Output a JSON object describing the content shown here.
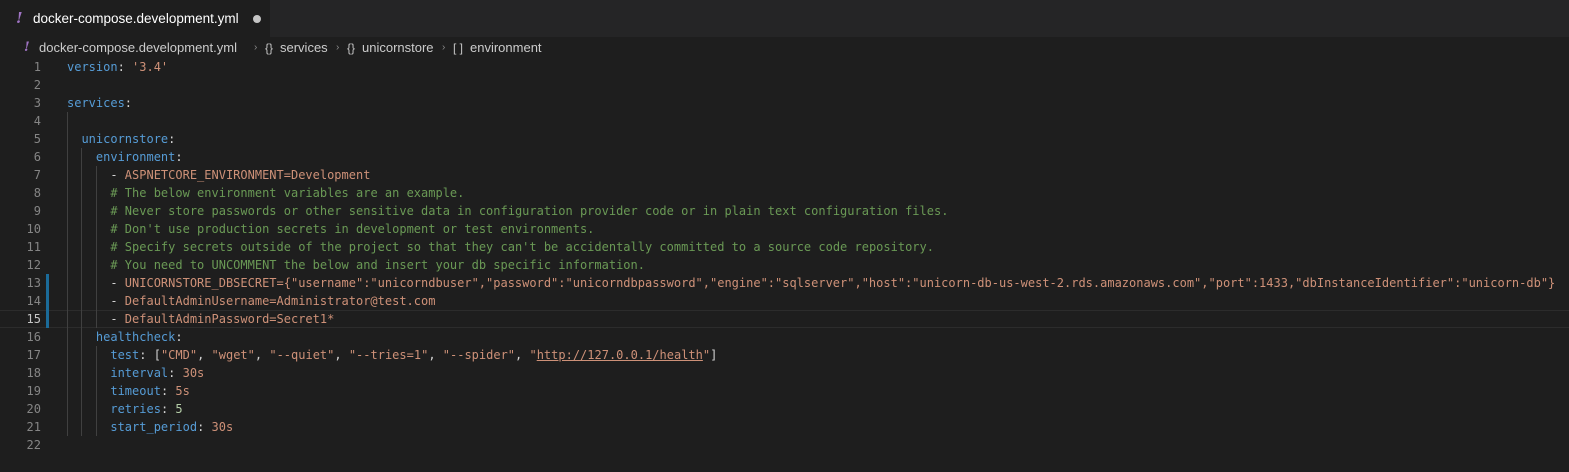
{
  "tab": {
    "icon": "yaml-file-icon",
    "title": "docker-compose.development.yml",
    "dirty": true
  },
  "breadcrumb": {
    "file": "docker-compose.development.yml",
    "items": [
      {
        "symbol": "{}",
        "label": "services"
      },
      {
        "symbol": "{}",
        "label": "unicornstore"
      },
      {
        "symbol": "[ ]",
        "label": "environment"
      }
    ]
  },
  "editor": {
    "current_line": 15,
    "lines": [
      {
        "n": "1",
        "tokens": [
          {
            "t": "version",
            "c": "k"
          },
          {
            "t": ": ",
            "c": "p"
          },
          {
            "t": "'3.4'",
            "c": "s"
          }
        ]
      },
      {
        "n": "2",
        "tokens": []
      },
      {
        "n": "3",
        "tokens": [
          {
            "t": "services",
            "c": "k"
          },
          {
            "t": ":",
            "c": "p"
          }
        ]
      },
      {
        "n": "4",
        "tokens": []
      },
      {
        "n": "5",
        "tokens": [
          {
            "t": "  ",
            "c": "p"
          },
          {
            "t": "unicornstore",
            "c": "k"
          },
          {
            "t": ":",
            "c": "p"
          }
        ]
      },
      {
        "n": "6",
        "tokens": [
          {
            "t": "    ",
            "c": "p"
          },
          {
            "t": "environment",
            "c": "k"
          },
          {
            "t": ":",
            "c": "p"
          }
        ]
      },
      {
        "n": "7",
        "tokens": [
          {
            "t": "      - ",
            "c": "p"
          },
          {
            "t": "ASPNETCORE_ENVIRONMENT=Development",
            "c": "s"
          }
        ]
      },
      {
        "n": "8",
        "tokens": [
          {
            "t": "      ",
            "c": "p"
          },
          {
            "t": "# The below environment variables are an example.",
            "c": "c"
          }
        ]
      },
      {
        "n": "9",
        "tokens": [
          {
            "t": "      ",
            "c": "p"
          },
          {
            "t": "# Never store passwords or other sensitive data in configuration provider code or in plain text configuration files.",
            "c": "c"
          }
        ]
      },
      {
        "n": "10",
        "tokens": [
          {
            "t": "      ",
            "c": "p"
          },
          {
            "t": "# Don't use production secrets in development or test environments.",
            "c": "c"
          }
        ]
      },
      {
        "n": "11",
        "tokens": [
          {
            "t": "      ",
            "c": "p"
          },
          {
            "t": "# Specify secrets outside of the project so that they can't be accidentally committed to a source code repository.",
            "c": "c"
          }
        ]
      },
      {
        "n": "12",
        "tokens": [
          {
            "t": "      ",
            "c": "p"
          },
          {
            "t": "# You need to UNCOMMENT the below and insert your db specific information.",
            "c": "c"
          }
        ]
      },
      {
        "n": "13",
        "tokens": [
          {
            "t": "      - ",
            "c": "p"
          },
          {
            "t": "UNICORNSTORE_DBSECRET={\"username\":\"unicorndbuser\",\"password\":\"unicorndbpassword\",\"engine\":\"sqlserver\",\"host\":\"unicorn-db-us-west-2.rds.amazonaws.com\",\"port\":1433,\"dbInstanceIdentifier\":\"unicorn-db\"}",
            "c": "s"
          }
        ]
      },
      {
        "n": "14",
        "tokens": [
          {
            "t": "      - ",
            "c": "p"
          },
          {
            "t": "DefaultAdminUsername=Administrator@test.com",
            "c": "s"
          }
        ]
      },
      {
        "n": "15",
        "tokens": [
          {
            "t": "      - ",
            "c": "p"
          },
          {
            "t": "DefaultAdminPassword=Secret1*",
            "c": "s"
          }
        ]
      },
      {
        "n": "16",
        "tokens": [
          {
            "t": "    ",
            "c": "p"
          },
          {
            "t": "healthcheck",
            "c": "k"
          },
          {
            "t": ":",
            "c": "p"
          }
        ]
      },
      {
        "n": "17",
        "tokens": [
          {
            "t": "      ",
            "c": "p"
          },
          {
            "t": "test",
            "c": "k"
          },
          {
            "t": ": [",
            "c": "p"
          },
          {
            "t": "\"CMD\"",
            "c": "s"
          },
          {
            "t": ", ",
            "c": "p"
          },
          {
            "t": "\"wget\"",
            "c": "s"
          },
          {
            "t": ", ",
            "c": "p"
          },
          {
            "t": "\"--quiet\"",
            "c": "s"
          },
          {
            "t": ", ",
            "c": "p"
          },
          {
            "t": "\"--tries=1\"",
            "c": "s"
          },
          {
            "t": ", ",
            "c": "p"
          },
          {
            "t": "\"--spider\"",
            "c": "s"
          },
          {
            "t": ", ",
            "c": "p"
          },
          {
            "t": "\"",
            "c": "s"
          },
          {
            "t": "http://127.0.0.1/health",
            "c": "u"
          },
          {
            "t": "\"",
            "c": "s"
          },
          {
            "t": "]",
            "c": "p"
          }
        ]
      },
      {
        "n": "18",
        "tokens": [
          {
            "t": "      ",
            "c": "p"
          },
          {
            "t": "interval",
            "c": "k"
          },
          {
            "t": ": ",
            "c": "p"
          },
          {
            "t": "30s",
            "c": "s"
          }
        ]
      },
      {
        "n": "19",
        "tokens": [
          {
            "t": "      ",
            "c": "p"
          },
          {
            "t": "timeout",
            "c": "k"
          },
          {
            "t": ": ",
            "c": "p"
          },
          {
            "t": "5s",
            "c": "s"
          }
        ]
      },
      {
        "n": "20",
        "tokens": [
          {
            "t": "      ",
            "c": "p"
          },
          {
            "t": "retries",
            "c": "k"
          },
          {
            "t": ": ",
            "c": "p"
          },
          {
            "t": "5",
            "c": "n"
          }
        ]
      },
      {
        "n": "21",
        "tokens": [
          {
            "t": "      ",
            "c": "p"
          },
          {
            "t": "start_period",
            "c": "k"
          },
          {
            "t": ": ",
            "c": "p"
          },
          {
            "t": "30s",
            "c": "s"
          }
        ]
      },
      {
        "n": "22",
        "tokens": []
      }
    ]
  }
}
